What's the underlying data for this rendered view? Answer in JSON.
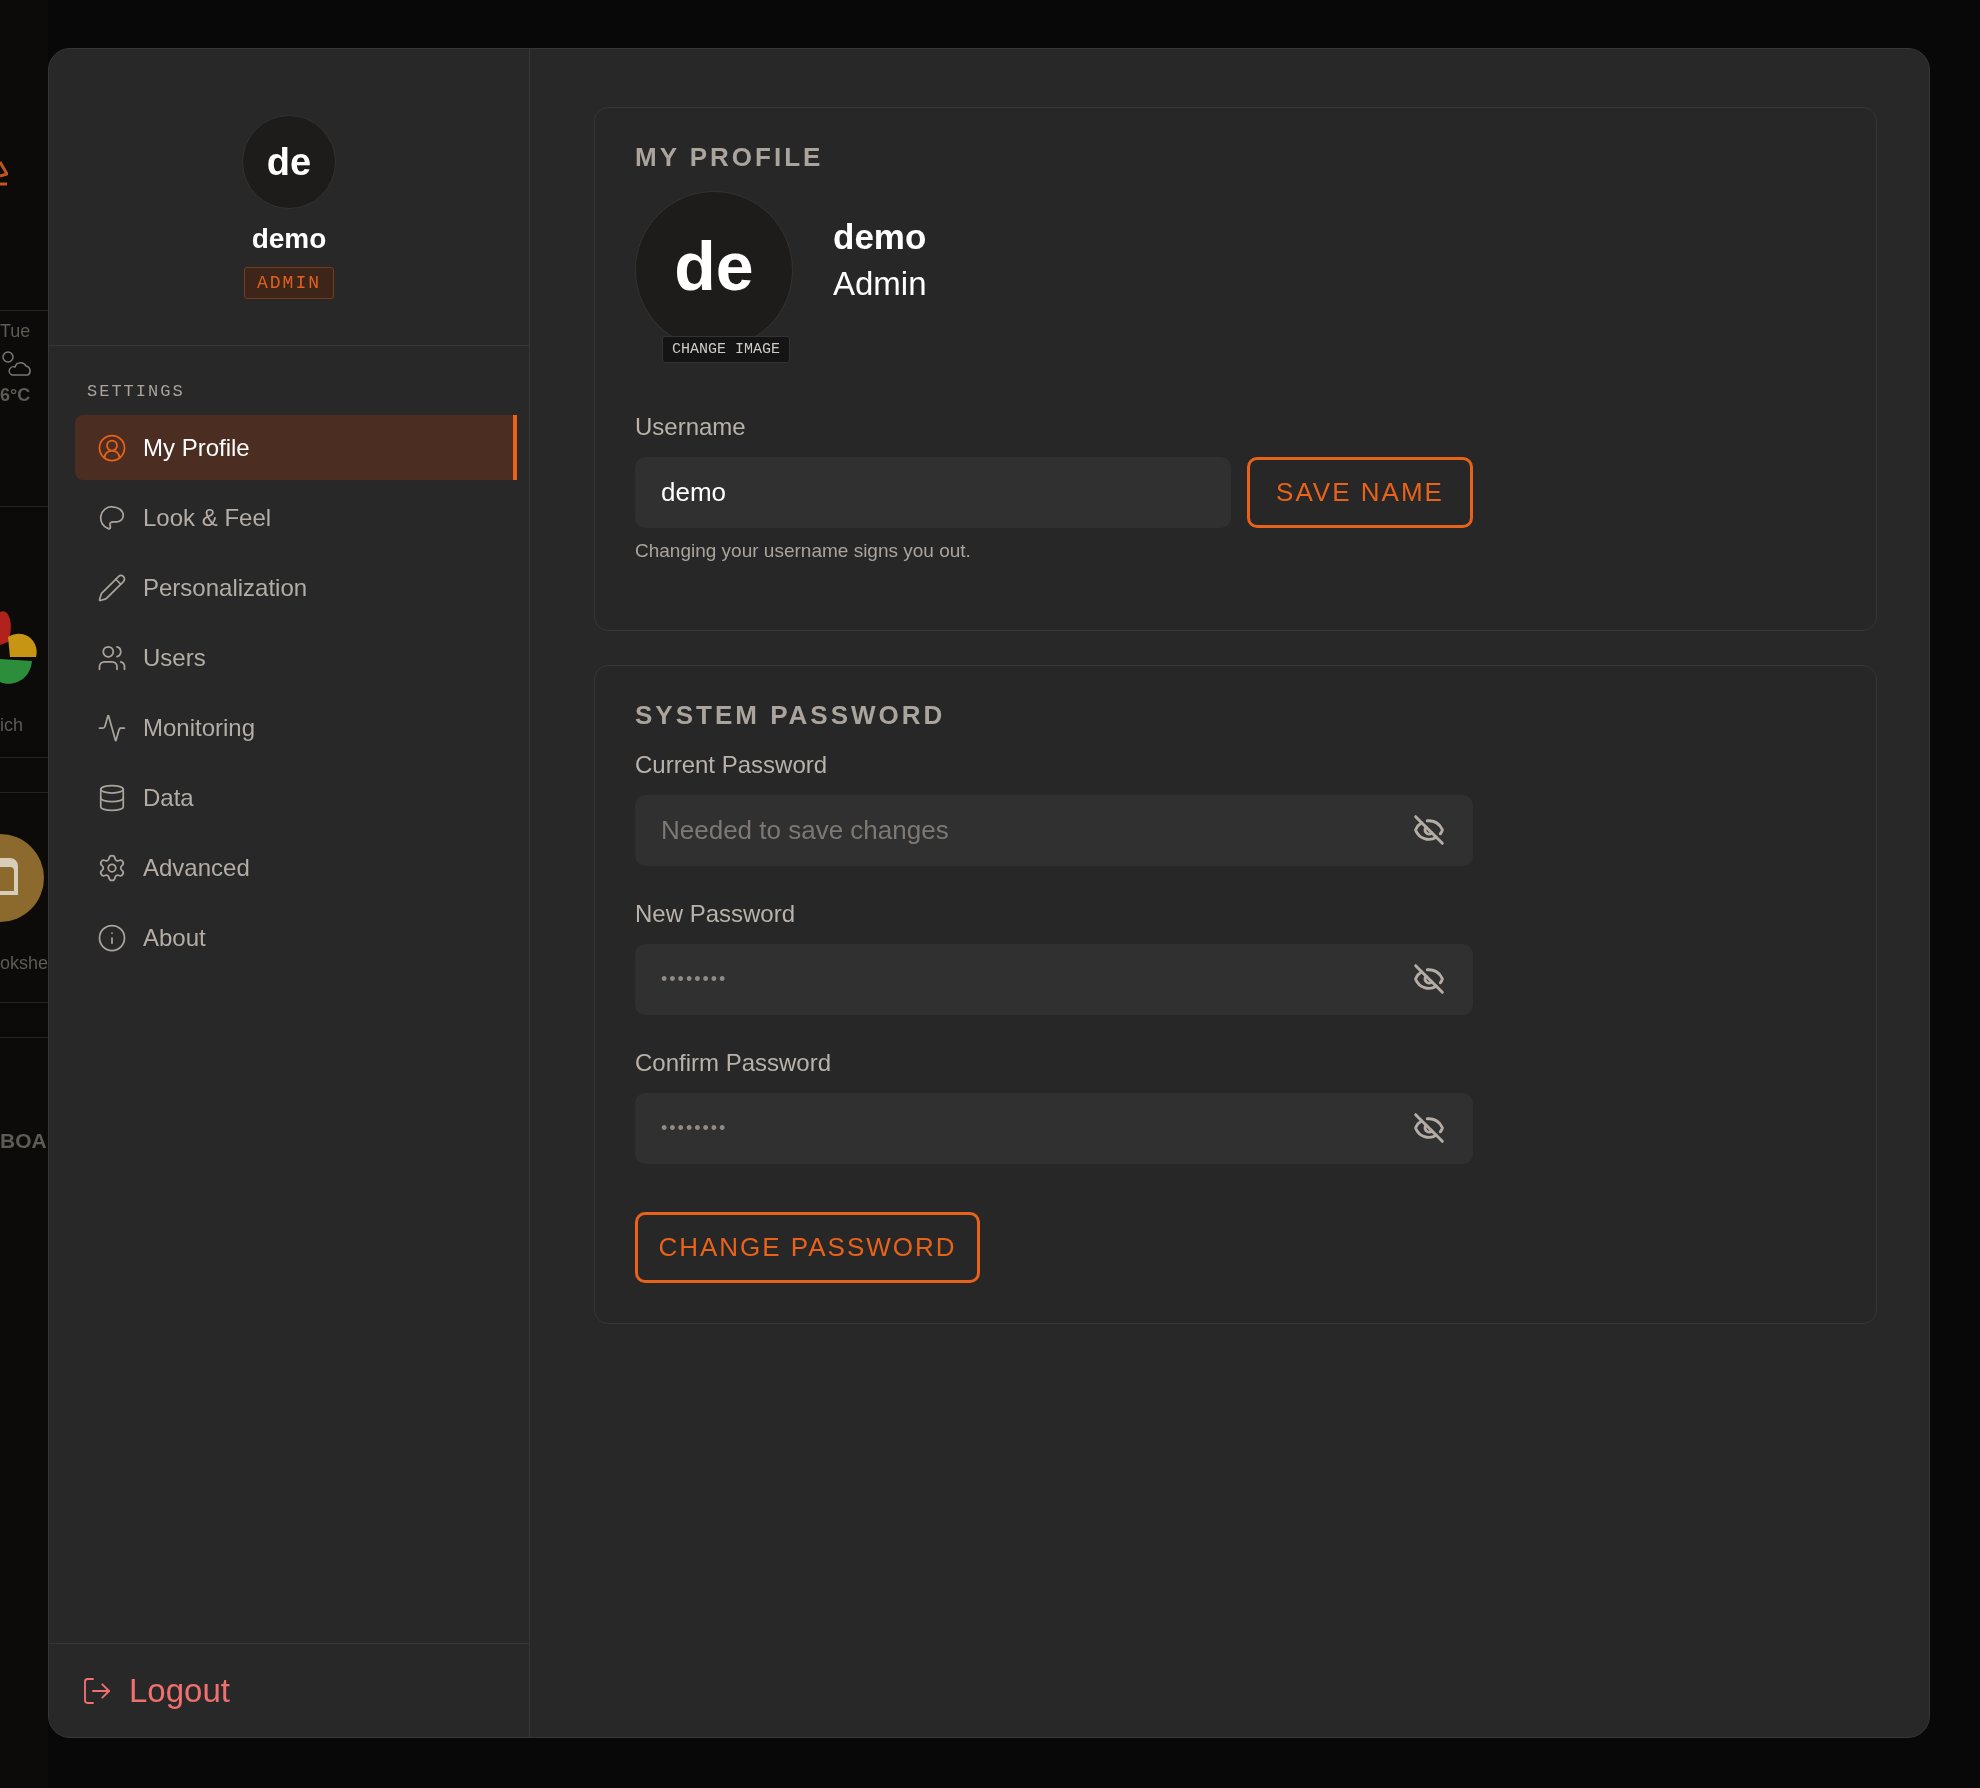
{
  "backdrop": {
    "labels": [
      "Tue",
      "6°C",
      "ich",
      "okshe",
      "BOA"
    ]
  },
  "sidebar": {
    "avatar_initials": "de",
    "name": "demo",
    "role_badge": "ADMIN",
    "section_label": "SETTINGS",
    "items": [
      {
        "kind": "profile",
        "label": "My Profile",
        "selected": true
      },
      {
        "kind": "palette",
        "label": "Look & Feel",
        "selected": false
      },
      {
        "kind": "pencil",
        "label": "Personalization",
        "selected": false
      },
      {
        "kind": "users",
        "label": "Users",
        "selected": false
      },
      {
        "kind": "activity",
        "label": "Monitoring",
        "selected": false
      },
      {
        "kind": "database",
        "label": "Data",
        "selected": false
      },
      {
        "kind": "gear",
        "label": "Advanced",
        "selected": false
      },
      {
        "kind": "info",
        "label": "About",
        "selected": false
      }
    ],
    "logout": "Logout"
  },
  "profile_card": {
    "title": "MY PROFILE",
    "avatar_initials": "de",
    "change_image": "CHANGE IMAGE",
    "name": "demo",
    "role": "Admin",
    "username_label": "Username",
    "username_value": "demo",
    "save_button": "SAVE NAME",
    "hint": "Changing your username signs you out."
  },
  "password_card": {
    "title": "SYSTEM PASSWORD",
    "fields": [
      {
        "label": "Current Password",
        "placeholder": "Needed to save changes"
      },
      {
        "label": "New Password",
        "value": "••••••••"
      },
      {
        "label": "Confirm Password",
        "value": "••••••••"
      }
    ],
    "button": "CHANGE PASSWORD"
  }
}
